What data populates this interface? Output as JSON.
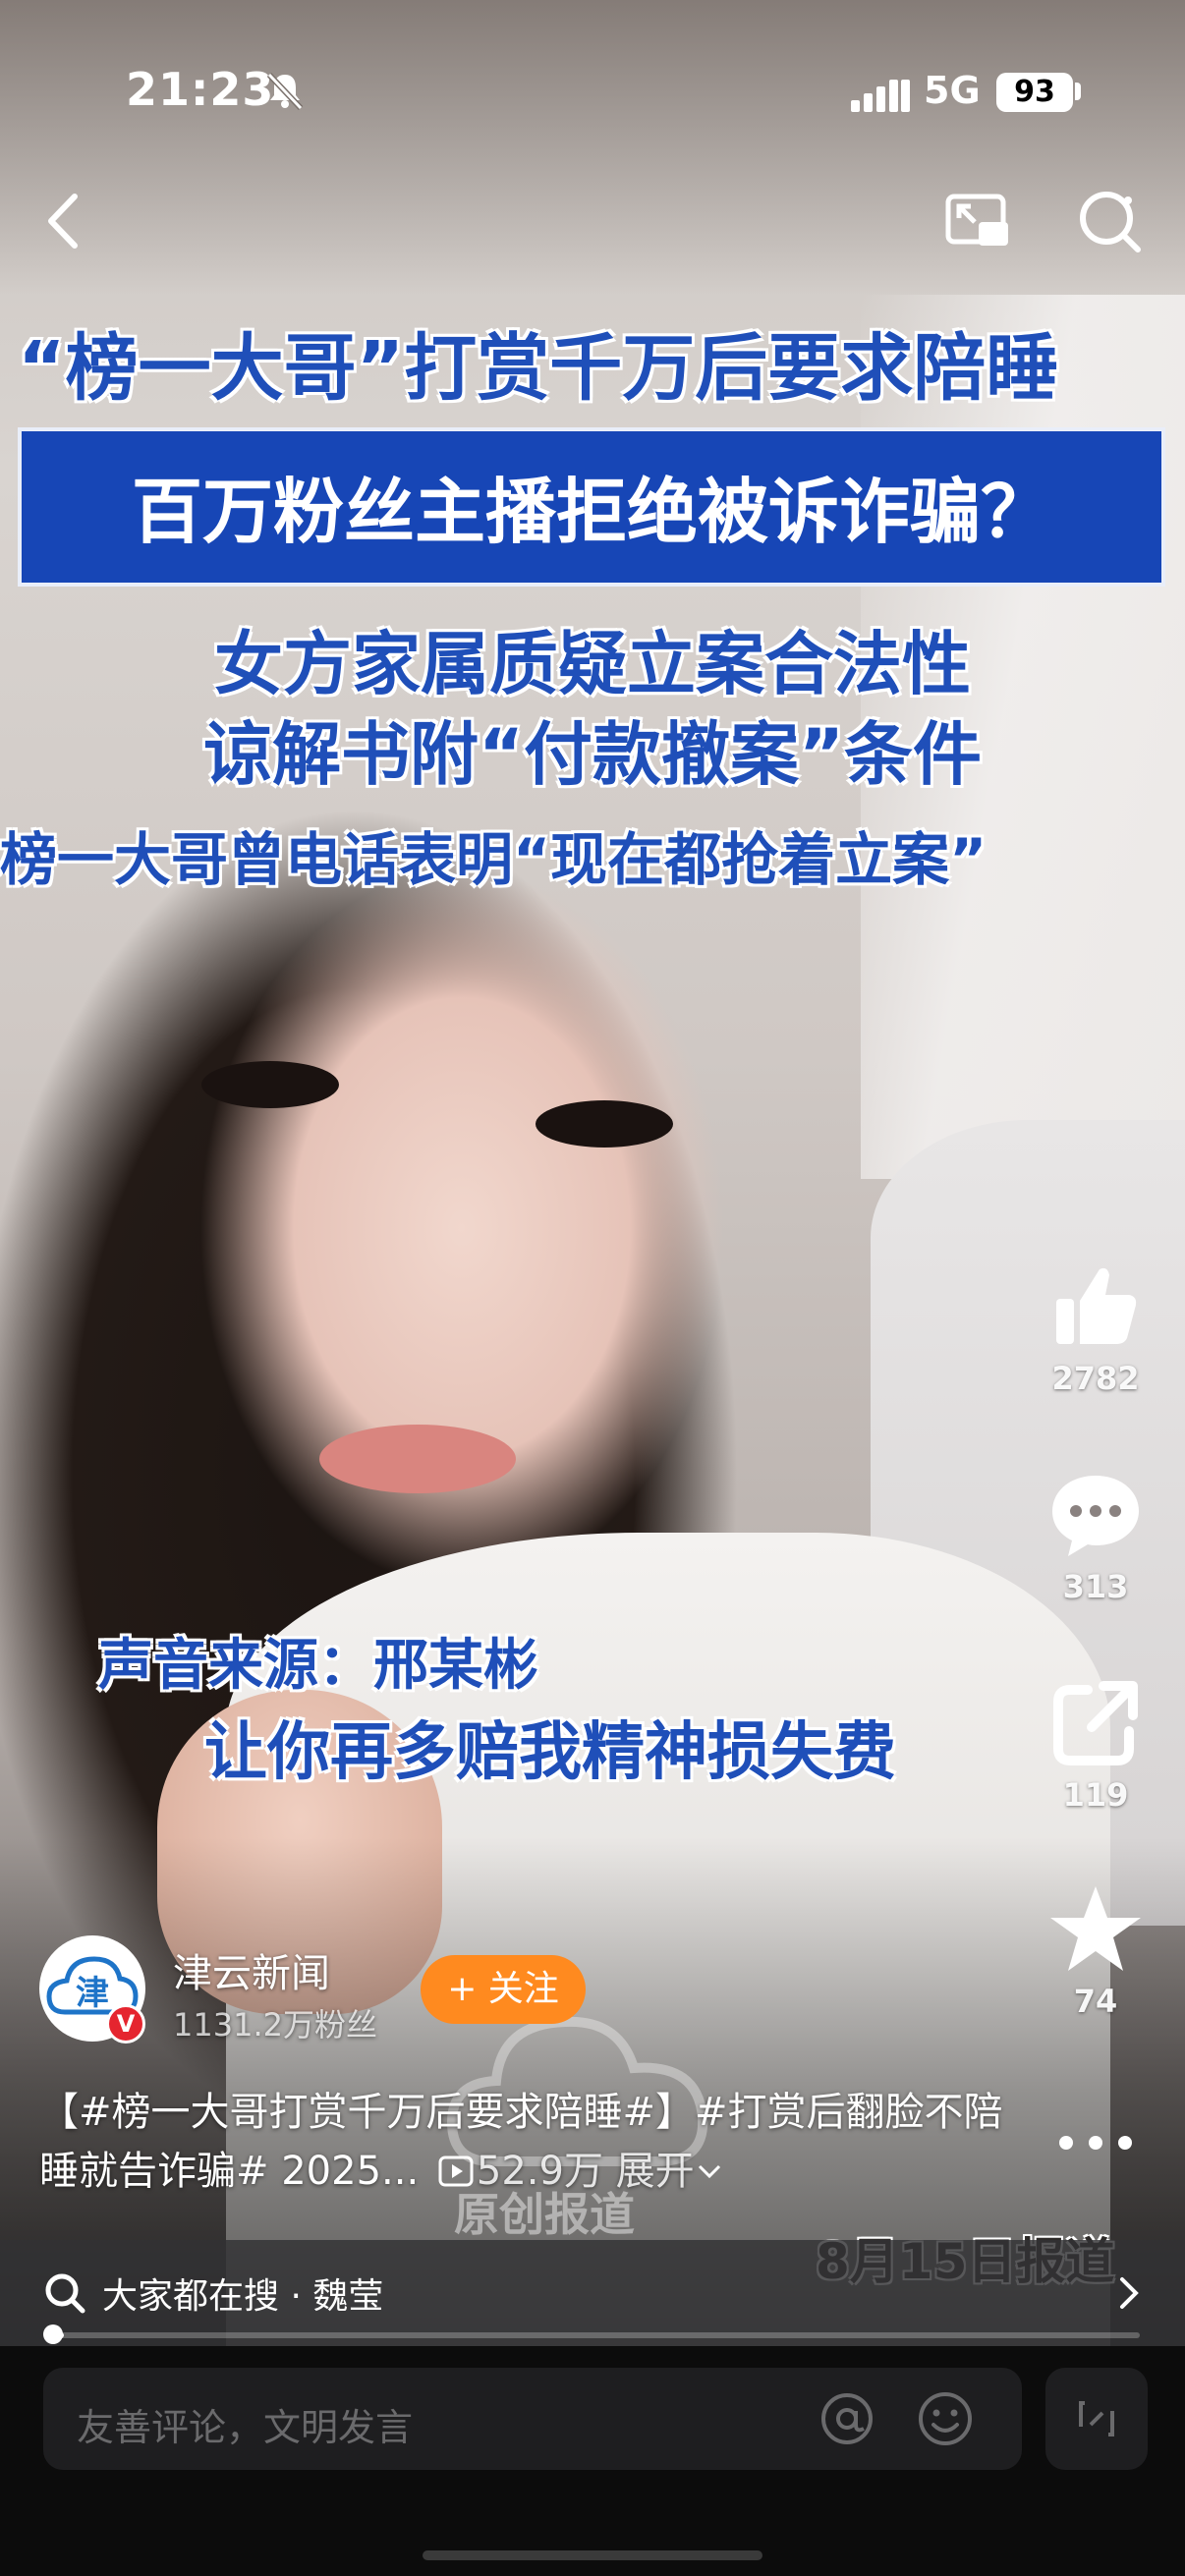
{
  "status_bar": {
    "time": "21:23",
    "network": "5G",
    "battery": "93"
  },
  "video": {
    "headline_line1": "“榜一大哥”打赏千万后要求陪睡",
    "headline_line2": "百万粉丝主播拒绝被诉诈骗？",
    "headline_line3": "女方家属质疑立案合法性",
    "headline_line4": "谅解书附“付款撤案”条件",
    "headline_line5": "榜一大哥曾电话表明“现在都抢着立案”",
    "subtitle_source": "声音来源：邢某彬",
    "subtitle_quote": "让你再多赔我精神损失费",
    "watermark_text": "原创报道",
    "date_stamp": "8月15日报道"
  },
  "actions": {
    "like_count": "2782",
    "comment_count": "313",
    "share_count": "119",
    "favorite_count": "74"
  },
  "author": {
    "name": "津云新闻",
    "fans": "1131.2万粉丝",
    "avatar_char": "津",
    "verified_mark": "V",
    "follow_label": "+ 关注"
  },
  "caption": {
    "text": "【#榜一大哥打赏千万后要求陪睡#】#打赏后翻脸不陪睡就告诈骗# 2025...",
    "views": "52.9万",
    "expand": "展开"
  },
  "search": {
    "prefix": "大家都在搜",
    "term": "魏莹"
  },
  "progress": {
    "fraction": 0.01
  },
  "comment": {
    "placeholder": "友善评论，文明发言"
  },
  "colors": {
    "follow": "#ff8a1f",
    "headline_blue": "#1f4fb9",
    "verified": "#e5252f"
  }
}
